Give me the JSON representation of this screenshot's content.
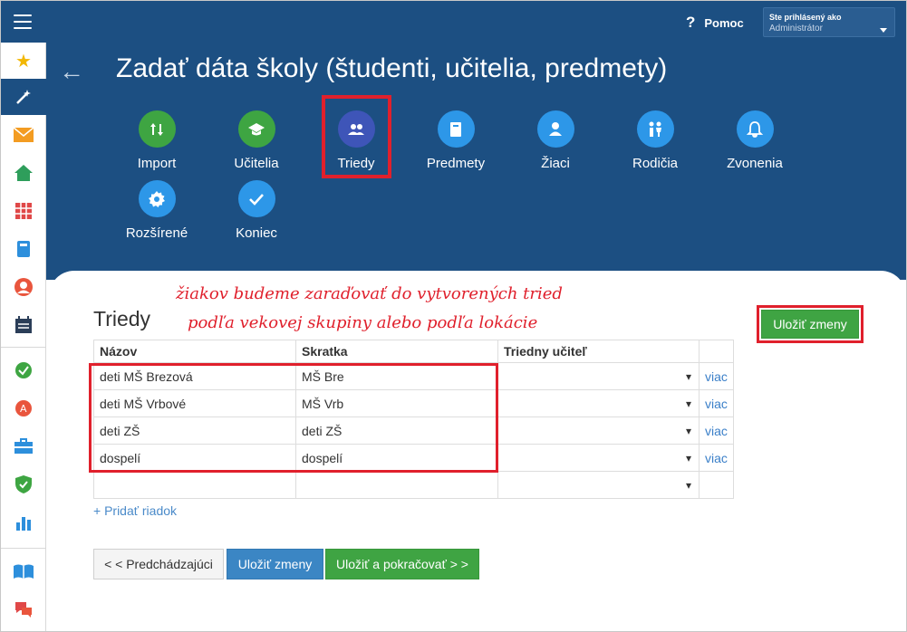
{
  "topbar": {
    "help_icon": "?",
    "help_label": "Pomoc",
    "user_line1": "Ste prihlásený ako",
    "user_line2": "Administrátor"
  },
  "sidebar": {
    "icons": [
      "star-icon",
      "wand-icon",
      "mail-icon",
      "home-icon",
      "calendar-grid-icon",
      "book-icon",
      "person-icon",
      "schedule-icon",
      "check-icon",
      "grade-icon",
      "briefcase-icon",
      "shield-icon",
      "chart-icon",
      "open-book-icon",
      "chat-icon"
    ]
  },
  "header": {
    "back_icon": "←",
    "title": "Zadať dáta školy (študenti, učitelia, predmety)"
  },
  "steps": [
    {
      "label": "Import",
      "icon": "swap-icon"
    },
    {
      "label": "Učitelia",
      "icon": "graduation-cap-icon"
    },
    {
      "label": "Triedy",
      "icon": "group-icon"
    },
    {
      "label": "Predmety",
      "icon": "book-icon"
    },
    {
      "label": "Žiaci",
      "icon": "user-icon"
    },
    {
      "label": "Rodičia",
      "icon": "family-icon"
    },
    {
      "label": "Zvonenia",
      "icon": "bell-icon"
    },
    {
      "label": "Rozšírené",
      "icon": "gear-icon"
    },
    {
      "label": "Koniec",
      "icon": "check-icon"
    }
  ],
  "content": {
    "section_title": "Triedy",
    "annotation_line1": "žiakov budeme zaraďovať do vytvorených tried",
    "annotation_line2": "podľa vekovej skupiny alebo podľa lokácie",
    "save_top": "Uložiť zmeny"
  },
  "table": {
    "headers": [
      "Názov",
      "Skratka",
      "Triedny učiteľ",
      ""
    ],
    "rows": [
      {
        "name": "deti MŠ Brezová",
        "abbr": "MŠ Bre",
        "more": "viac"
      },
      {
        "name": "deti MŠ Vrbové",
        "abbr": "MŠ Vrb",
        "more": "viac"
      },
      {
        "name": "deti ZŠ",
        "abbr": "deti ZŠ",
        "more": "viac"
      },
      {
        "name": "dospelí",
        "abbr": "dospelí",
        "more": "viac"
      }
    ],
    "add_row": "+ Pridať riadok"
  },
  "buttons": {
    "prev": "< < Predchádzajúci",
    "save": "Uložiť zmeny",
    "next": "Uložiť a pokračovať > >"
  }
}
